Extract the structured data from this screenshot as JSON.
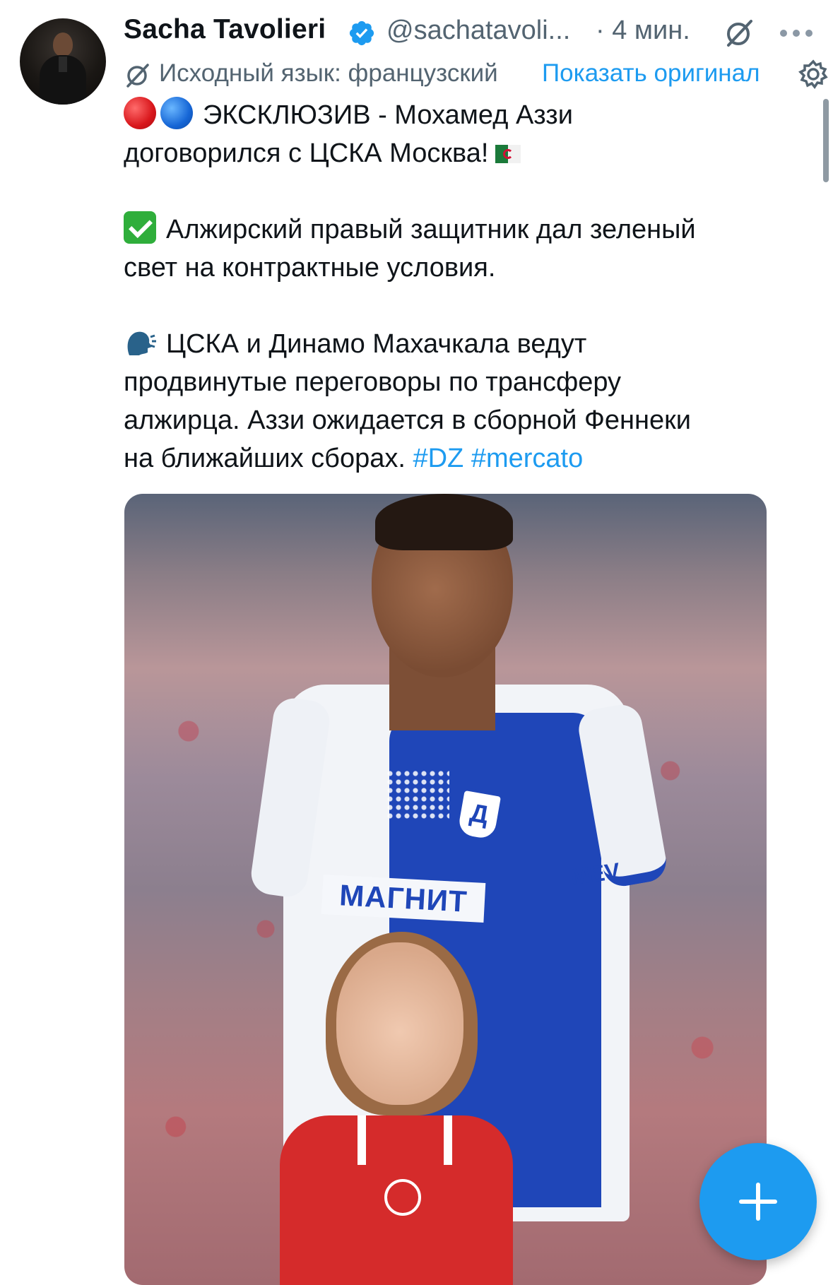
{
  "author": {
    "name": "Sacha Tavolieri",
    "handle": "@sachatavoli...",
    "time": "· 4 мин."
  },
  "translation": {
    "label": "Исходный язык: французский",
    "show_original": "Показать оригинал"
  },
  "tweet": {
    "line1": "ЭКСКЛЮЗИВ - Мохамед Аззи",
    "line2": "договорился с ЦСКА Москва!",
    "point1_l1": "Алжирский правый защитник дал зеленый",
    "point1_l2": "свет на контрактные условия.",
    "point2_l1": "ЦСКА и Динамо Махачкала ведут",
    "point2_l2": "продвинутые переговоры по трансферу",
    "point2_l3": "алжирца. Аззи ожидается в сборной Феннеки",
    "point2_l4": "на ближайших сборах.",
    "hashtags": [
      "#DZ",
      "#mercato"
    ]
  },
  "media": {
    "sponsor_text": "МАГНИТ",
    "sleeve_sponsor": "MEV",
    "club_badge": "Д"
  },
  "icons": {
    "verified": "verified-badge-icon",
    "grok": "grok-icon",
    "more": "more-dots-icon",
    "translate": "translate-icon",
    "settings": "gear-icon",
    "compose": "plus-icon"
  },
  "colors": {
    "accent": "#1d9bf0",
    "secondary_text": "#536471",
    "primary_text": "#0f1419"
  }
}
